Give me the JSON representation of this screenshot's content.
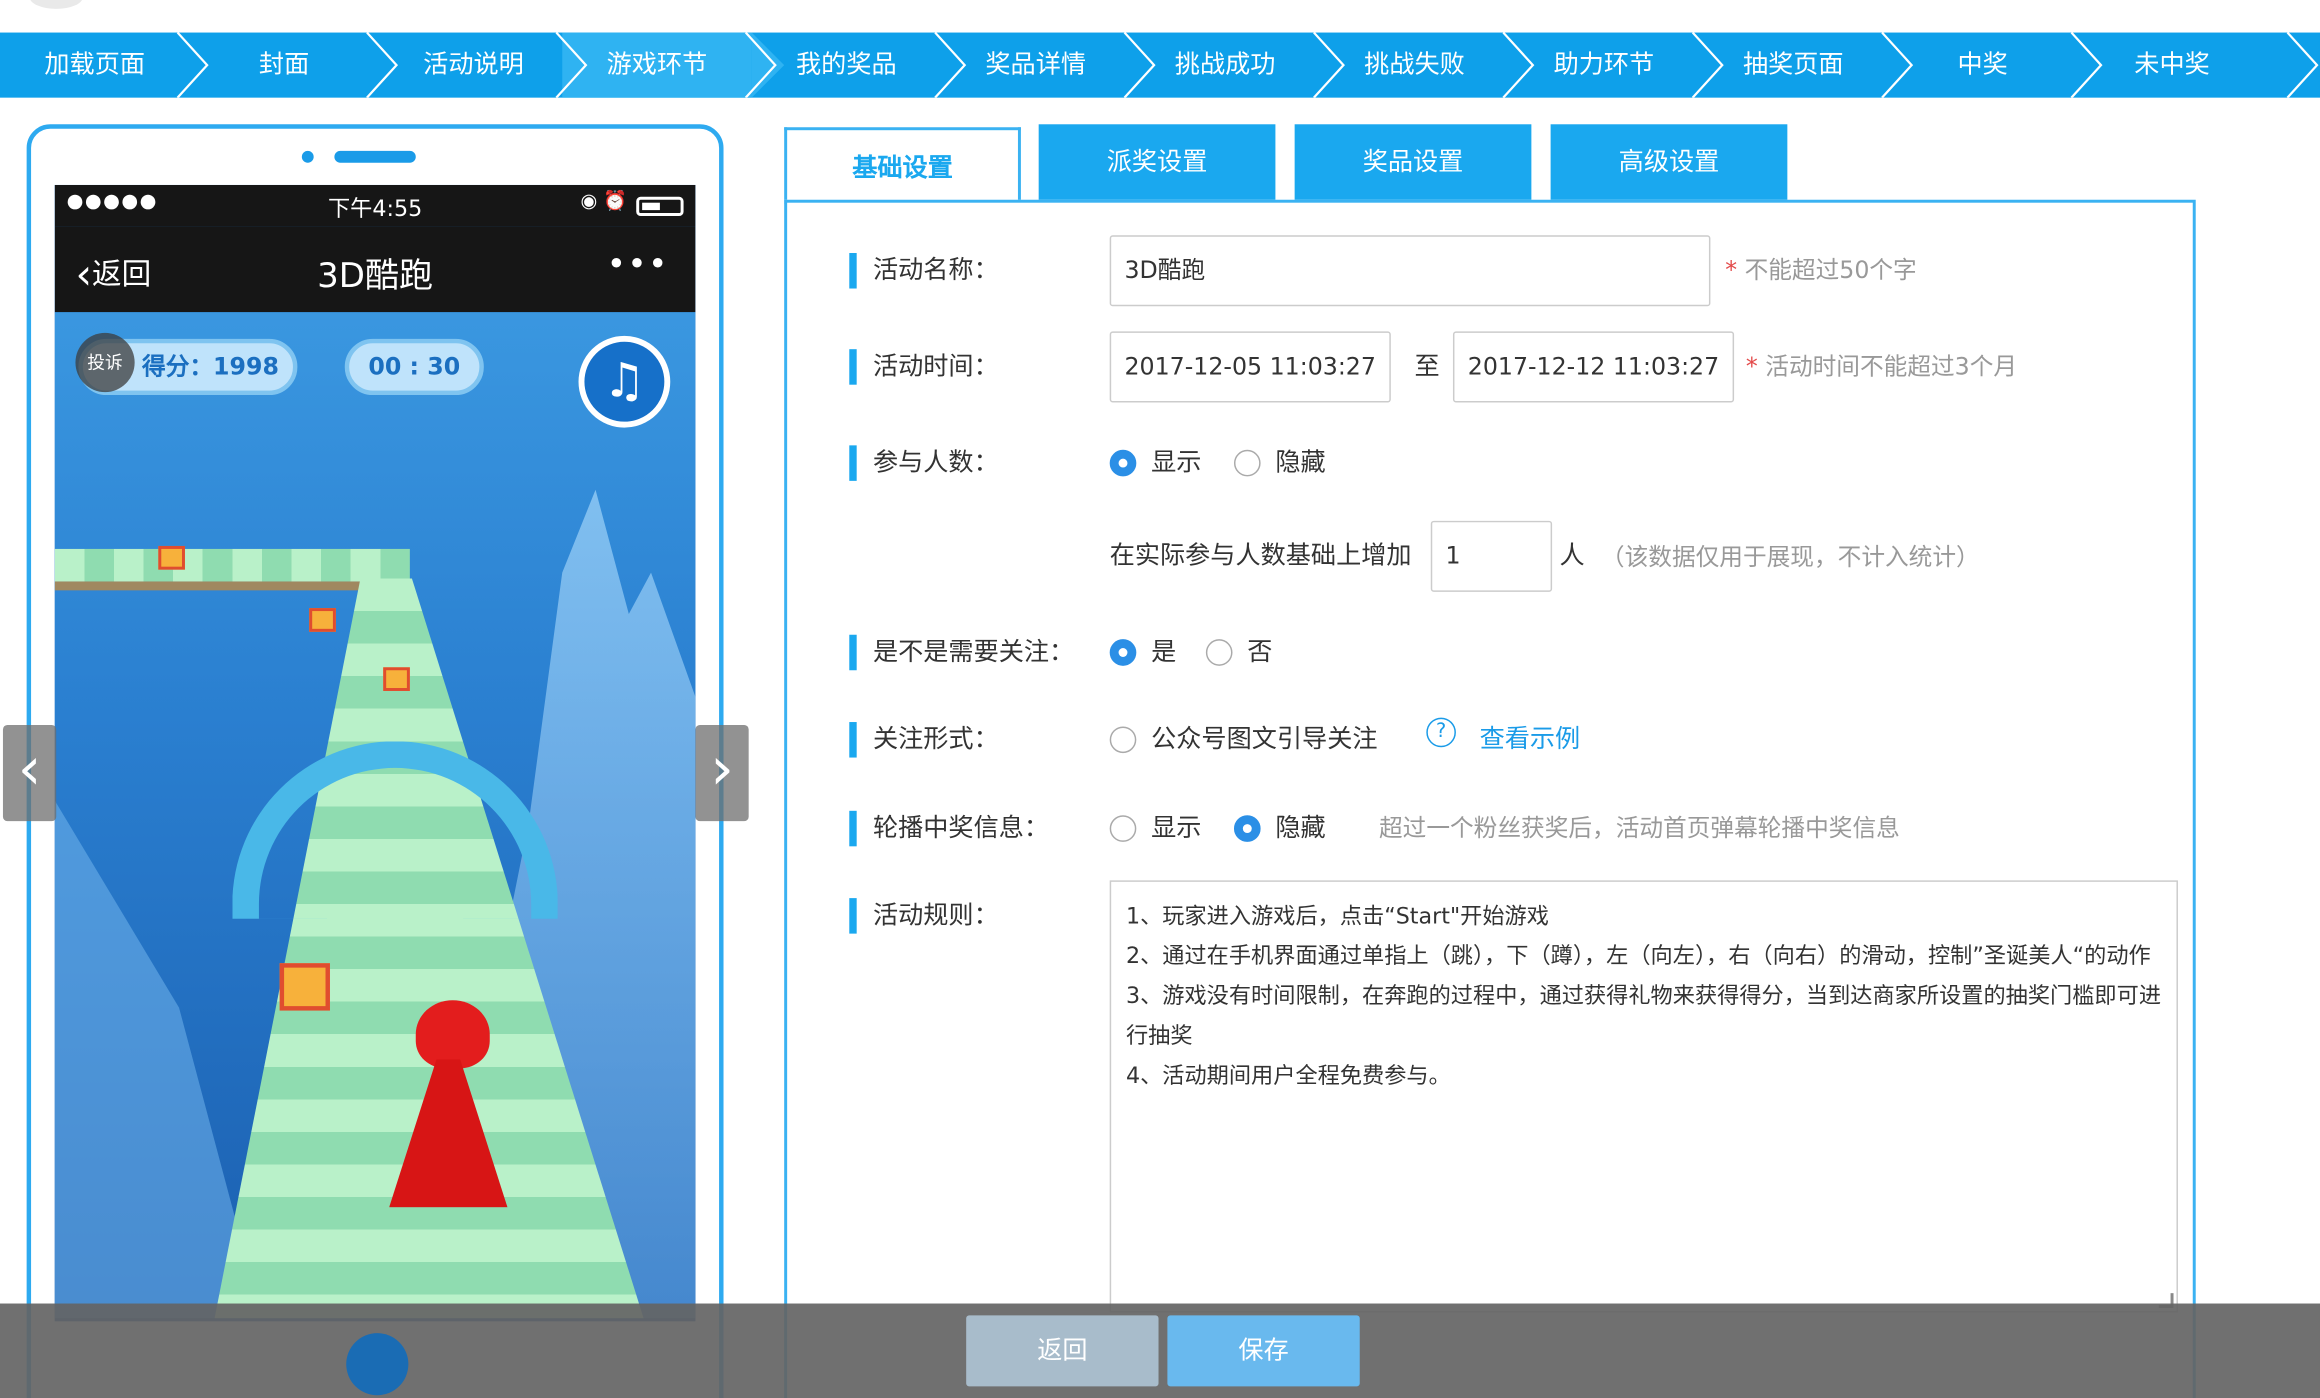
{
  "steps": [
    "加载页面",
    "封面",
    "活动说明",
    "游戏环节",
    "我的奖品",
    "奖品详情",
    "挑战成功",
    "挑战失败",
    "助力环节",
    "抽奖页面",
    "中奖",
    "未中奖"
  ],
  "active_step": "游戏环节",
  "phone": {
    "status_signal": "●●●●●",
    "status_time": "下午4:55",
    "status_icons": "◉ ⏰",
    "back_label": "返回",
    "back_icon": "‹",
    "title": "3D酷跑",
    "more_icon": "•••",
    "hud": {
      "report_label": "投诉",
      "score": "得分：1998",
      "timer": "00 : 30",
      "music_icon": "♫"
    }
  },
  "carousel": {
    "prev_icon": "‹",
    "next_icon": "›"
  },
  "tabs": [
    "基础设置",
    "派奖设置",
    "奖品设置",
    "高级设置"
  ],
  "form": {
    "activity_name": {
      "label": "活动名称：",
      "value": "3D酷跑",
      "hint_star": "*",
      "hint": " 不能超过50个字"
    },
    "activity_time": {
      "label": "活动时间：",
      "start": "2017-12-05 11:03:27",
      "to": "至",
      "end": "2017-12-12 11:03:27",
      "hint_star": "*",
      "hint": " 活动时间不能超过3个月"
    },
    "participants": {
      "label": "参与人数：",
      "show": "显示",
      "hide": "隐藏",
      "selected": "显示",
      "increase_prefix": "在实际参与人数基础上增加",
      "increase_value": "1",
      "increase_unit": "人",
      "increase_note": "（该数据仅用于展现，不计入统计）"
    },
    "need_follow": {
      "label": "是不是需要关注：",
      "yes": "是",
      "no": "否",
      "selected": "是"
    },
    "follow_type": {
      "label": "关注形式：",
      "option": "公众号图文引导关注",
      "help_icon": "?",
      "example_link": "查看示例"
    },
    "carousel_winners": {
      "label": "轮播中奖信息：",
      "show": "显示",
      "hide": "隐藏",
      "selected": "隐藏",
      "note": "超过一个粉丝获奖后，活动首页弹幕轮播中奖信息"
    },
    "rules": {
      "label": "活动规则：",
      "lines": [
        "1、玩家进入游戏后，点击“Start\"开始游戏",
        "2、通过在手机界面通过单指上（跳），下（蹲），左（向左），右（向右）的滑动，控制”圣诞美人“的动作",
        "3、游戏没有时间限制，在奔跑的过程中，通过获得礼物来获得得分，当到达商家所设置的抽奖门槛即可进行抽奖",
        "4、活动期间用户全程免费参与。"
      ]
    }
  },
  "buttons": {
    "back": "返回",
    "save": "保存"
  },
  "colors": {
    "accent": "#0ea0ea",
    "tab": "#1aa8ef",
    "required": "#e34b4b",
    "radio_on": "#2b8fe6"
  }
}
